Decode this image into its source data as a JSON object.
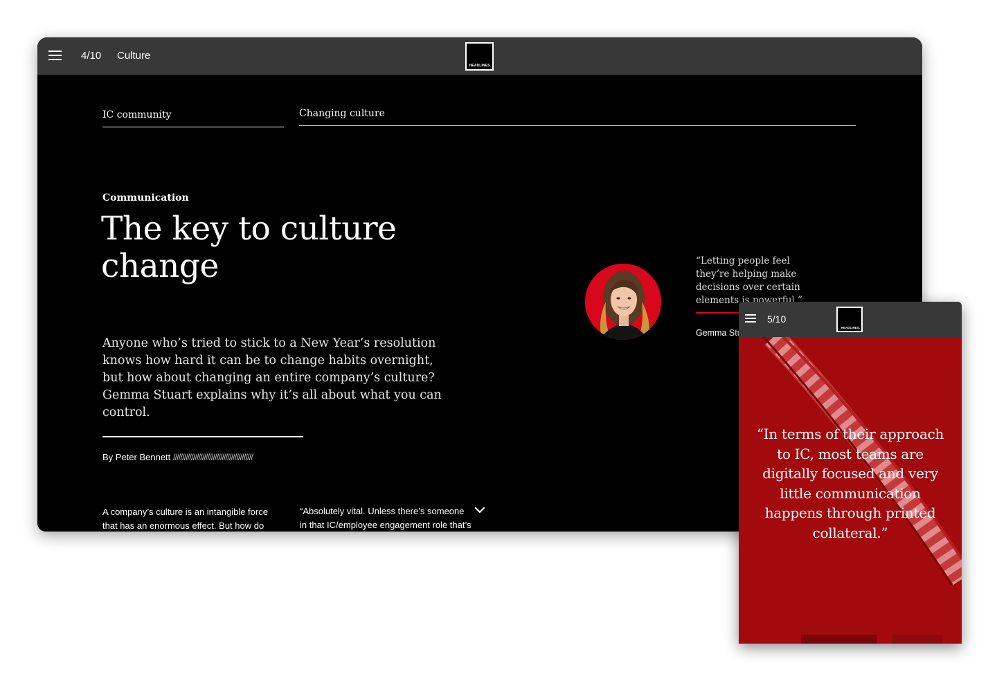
{
  "desktop": {
    "header": {
      "page_count": "4/10",
      "section": "Culture",
      "logo_text": "HEADLINES."
    },
    "tabs": [
      {
        "label": "IC community"
      },
      {
        "label": "Changing culture"
      }
    ],
    "article": {
      "kicker": "Communication",
      "title_line1": "The key to culture",
      "title_line2": "change",
      "intro": "Anyone who’s tried to stick to a New Year’s resolution knows how hard it can be to change habits overnight, but how about changing an entire company’s culture? Gemma Stuart explains why it’s all about what you can control.",
      "byline": "By Peter Bennett",
      "byline_decoration": "////////////////////////////////////////////",
      "body_col1": "A company’s culture is an intangible force that has an enormous effect. But how do",
      "body_col2": "“Absolutely vital. Unless there’s someone in that IC/employee engagement role that’s"
    },
    "pull_quote": {
      "text": "“Letting people feel they’re helping make decisions over certain elements is powerful.”",
      "author": "Gemma Stuart"
    }
  },
  "mobile": {
    "header": {
      "page_count": "5/10",
      "logo_text": "HEADLINES."
    },
    "quote": "“In terms of their approach to IC, most teams are digitally focused and very little communication happens through printed collateral.”"
  },
  "colors": {
    "top_bar": "#383838",
    "accent_red": "#d9071b",
    "mobile_background": "#a20a0d",
    "page_background": "#000000"
  },
  "icons": [
    "hamburger-icon",
    "chevron-down-icon"
  ]
}
